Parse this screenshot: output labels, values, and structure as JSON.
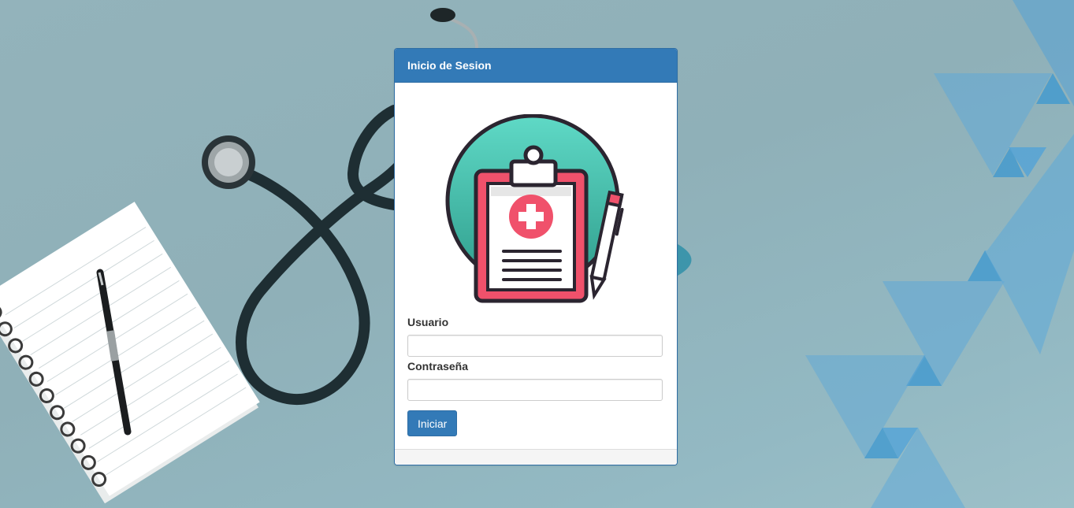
{
  "login": {
    "title": "Inicio de Sesion",
    "username_label": "Usuario",
    "username_value": "",
    "password_label": "Contraseña",
    "password_value": "",
    "submit_label": "Iniciar"
  },
  "colors": {
    "primary": "#337ab7",
    "primary_border": "#2e6da4",
    "logo_circle": "#3fc1b0",
    "logo_board": "#f0516b",
    "logo_outline": "#2b2530"
  },
  "icons": {
    "logo": "medical-clipboard-icon"
  }
}
